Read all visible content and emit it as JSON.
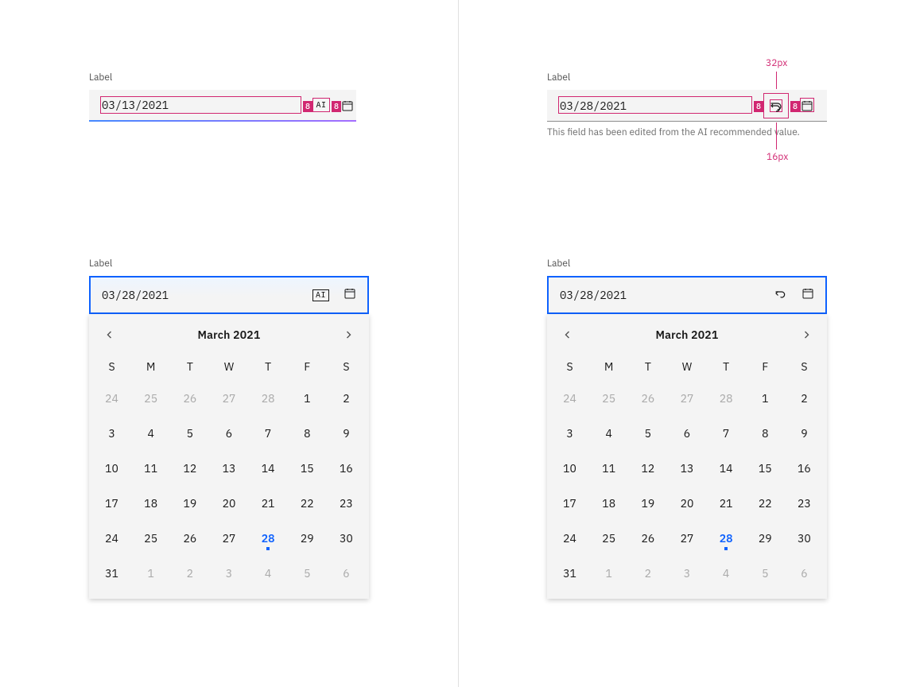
{
  "colors": {
    "spec": "#d12771",
    "focus": "#0f62fe"
  },
  "spec": {
    "paddings": {
      "after_text": "8",
      "between_icons": "8",
      "after_undo": "8"
    },
    "dims": {
      "icon_box": "32px",
      "icon_glyph": "16px"
    }
  },
  "left": {
    "top": {
      "label": "Label",
      "value": "03/13/2021"
    },
    "calendar": {
      "label": "Label",
      "value": "03/28/2021",
      "title": "March  2021",
      "selected": 28,
      "dow": [
        "S",
        "M",
        "T",
        "W",
        "T",
        "F",
        "S"
      ],
      "leading": [
        24,
        25,
        26,
        27,
        28
      ],
      "days": [
        1,
        2,
        3,
        4,
        5,
        6,
        7,
        8,
        9,
        10,
        11,
        12,
        13,
        14,
        15,
        16,
        17,
        18,
        19,
        20,
        21,
        22,
        23,
        24,
        25,
        26,
        27,
        28,
        29,
        30,
        31
      ],
      "trailing": [
        1,
        2,
        3,
        4,
        5,
        6
      ]
    }
  },
  "right": {
    "top": {
      "label": "Label",
      "value": "03/28/2021",
      "helper": "This field has been edited from the AI recommended value."
    },
    "calendar": {
      "label": "Label",
      "value": "03/28/2021",
      "title": "March  2021",
      "selected": 28,
      "dow": [
        "S",
        "M",
        "T",
        "W",
        "T",
        "F",
        "S"
      ],
      "leading": [
        24,
        25,
        26,
        27,
        28
      ],
      "days": [
        1,
        2,
        3,
        4,
        5,
        6,
        7,
        8,
        9,
        10,
        11,
        12,
        13,
        14,
        15,
        16,
        17,
        18,
        19,
        20,
        21,
        22,
        23,
        24,
        25,
        26,
        27,
        28,
        29,
        30,
        31
      ],
      "trailing": [
        1,
        2,
        3,
        4,
        5,
        6
      ]
    }
  }
}
